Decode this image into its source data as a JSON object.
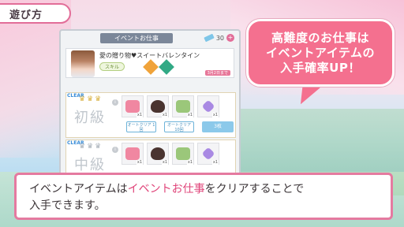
{
  "screen": {
    "title": "遊び方"
  },
  "panel": {
    "header_title": "イベントお仕事",
    "ticket_count": "30",
    "ticket_icon": "ticket-icon",
    "plus_icon": "plus-icon"
  },
  "event": {
    "title": "愛の贈り物♥スイートバレンタイン",
    "skill_label": "スキル",
    "expiry_label": "3月2日まで"
  },
  "levels": [
    {
      "clear": "CLEAR",
      "name": "初級",
      "crowns": [
        "gold",
        "gold",
        "gold"
      ],
      "items": [
        {
          "color": "pink",
          "qty": "x1"
        },
        {
          "color": "dark",
          "qty": "x1"
        },
        {
          "color": "green",
          "qty": "x1"
        },
        {
          "color": "purple",
          "qty": "x1"
        }
      ],
      "auto_clear_1": "オートクリア 1回",
      "auto_clear_2": "オートクリア 10回",
      "use_label": "3枚"
    },
    {
      "clear": "CLEAR",
      "name": "中級",
      "crowns": [
        "silver",
        "silver",
        "silver"
      ],
      "items": [
        {
          "color": "pink",
          "qty": "x1"
        },
        {
          "color": "dark",
          "qty": "x1"
        },
        {
          "color": "green",
          "qty": "x1"
        },
        {
          "color": "purple",
          "qty": "x1"
        }
      ]
    }
  ],
  "bubble": {
    "lines": [
      "高難度のお仕事は",
      "イベントアイテムの",
      "入手確率UP！"
    ]
  },
  "caption": {
    "line1_pre": "イベントアイテムは",
    "line1_highlight": "イベントお仕事",
    "line1_post": "をクリアすることで",
    "line2": "入手できます。"
  },
  "colors": {
    "accent_pink": "#e57aa0",
    "highlight": "#e0457a",
    "bubble": "#f4708f"
  }
}
